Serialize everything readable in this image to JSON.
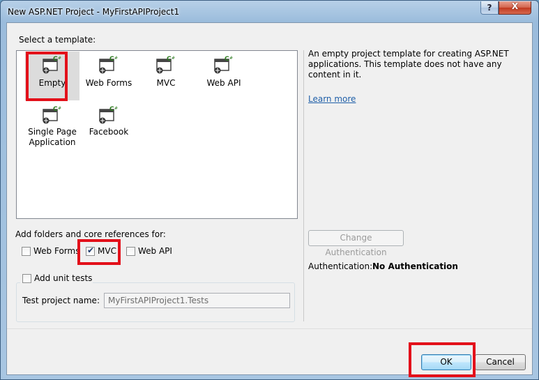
{
  "window": {
    "title": "New ASP.NET Project - MyFirstAPIProject1",
    "help_glyph": "?",
    "close_glyph": "X"
  },
  "template_section": {
    "label": "Select a template:",
    "templates": [
      {
        "name": "Empty",
        "selected": true,
        "icon": "web-project-csharp-icon"
      },
      {
        "name": "Web Forms",
        "selected": false,
        "icon": "web-project-csharp-icon"
      },
      {
        "name": "MVC",
        "selected": false,
        "icon": "web-project-csharp-icon"
      },
      {
        "name": "Web API",
        "selected": false,
        "icon": "web-project-csharp-icon"
      },
      {
        "name": "Single Page Application",
        "selected": false,
        "icon": "web-project-csharp-icon"
      },
      {
        "name": "Facebook",
        "selected": false,
        "icon": "web-project-csharp-icon"
      }
    ]
  },
  "description": {
    "text": "An empty project template for creating ASP.NET applications. This template does not have any content in it.",
    "learn_more": "Learn more"
  },
  "references": {
    "label": "Add folders and core references for:",
    "options": [
      {
        "label": "Web Forms",
        "checked": false
      },
      {
        "label": "MVC",
        "checked": true
      },
      {
        "label": "Web API",
        "checked": false
      }
    ]
  },
  "unit_tests": {
    "label": "Add unit tests",
    "checked": false,
    "test_project_label": "Test project name:",
    "test_project_value": "MyFirstAPIProject1.Tests"
  },
  "authentication": {
    "change_button": "Change Authentication",
    "label": "Authentication:",
    "value": "No Authentication"
  },
  "buttons": {
    "ok": "OK",
    "cancel": "Cancel"
  },
  "colors": {
    "highlight": "#e3101a",
    "link": "#1f5fa8"
  }
}
